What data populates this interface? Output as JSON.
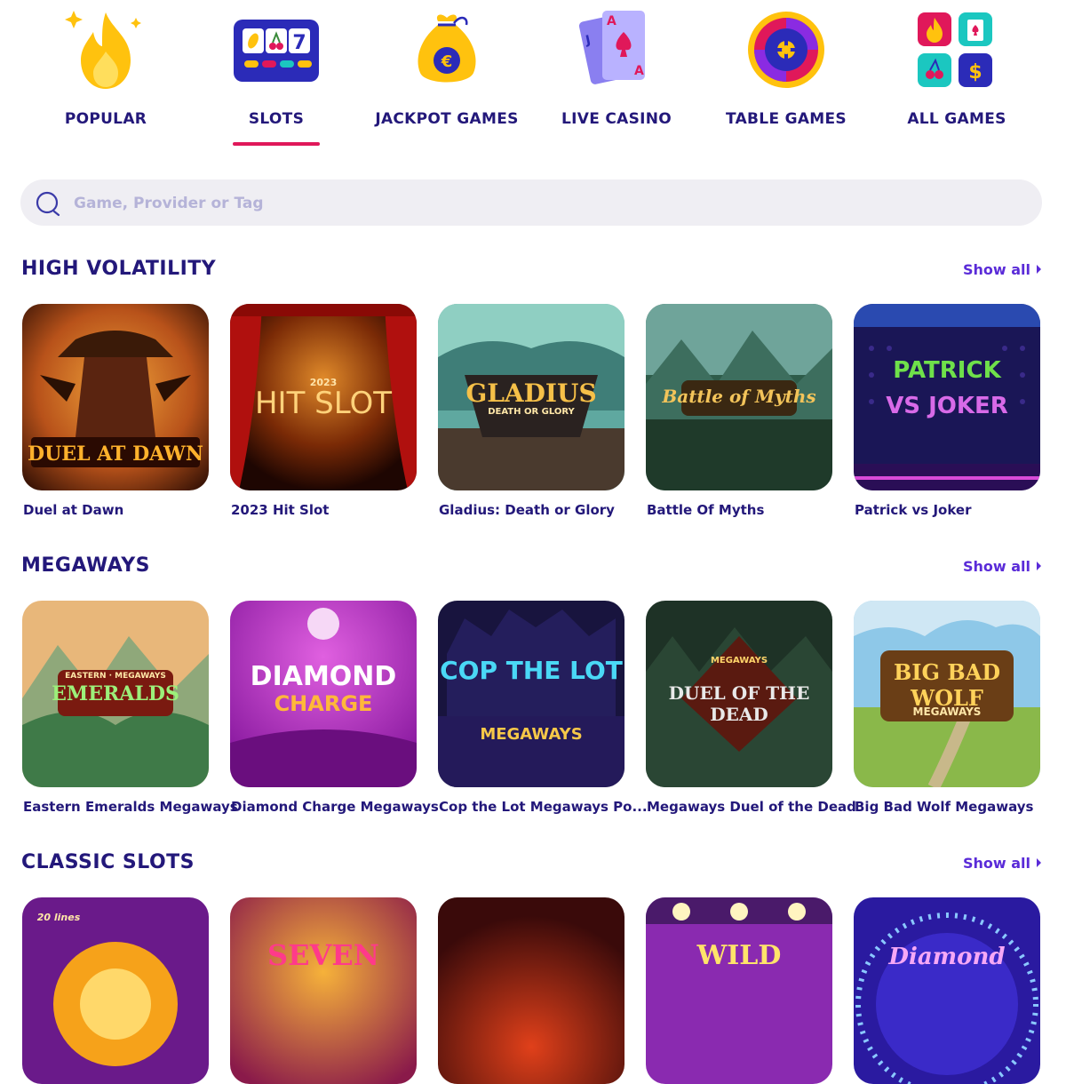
{
  "nav": {
    "categories": [
      {
        "label": "POPULAR",
        "icon": "fire-icon",
        "active": false
      },
      {
        "label": "SLOTS",
        "icon": "slot-machine-icon",
        "active": true
      },
      {
        "label": "JACKPOT GAMES",
        "icon": "money-bag-icon",
        "active": false
      },
      {
        "label": "LIVE CASINO",
        "icon": "playing-cards-icon",
        "active": false
      },
      {
        "label": "TABLE GAMES",
        "icon": "roulette-wheel-icon",
        "active": false
      },
      {
        "label": "ALL GAMES",
        "icon": "grid-tiles-icon",
        "active": false
      }
    ]
  },
  "search": {
    "placeholder": "Game, Provider or Tag",
    "value": ""
  },
  "sections": [
    {
      "title": "HIGH VOLATILITY",
      "show_all": "Show all",
      "games": [
        {
          "name": "Duel at Dawn",
          "art_text": "DUEL AT DAWN"
        },
        {
          "name": "2023 Hit Slot",
          "art_text": "HIT SLOT",
          "art_sub": "2023"
        },
        {
          "name": "Gladius: Death or Glory",
          "art_text": "GLADIUS",
          "art_sub": "DEATH OR GLORY"
        },
        {
          "name": "Battle Of Myths",
          "art_text": "Battle of Myths"
        },
        {
          "name": "Patrick vs Joker",
          "art_text": "PATRICK",
          "art_sub": "VS JOKER"
        }
      ]
    },
    {
      "title": "MEGAWAYS",
      "show_all": "Show all",
      "games": [
        {
          "name": "Eastern Emeralds Megaways",
          "art_text": "EMERALDS",
          "art_sub": "EASTERN · MEGAWAYS"
        },
        {
          "name": "Diamond Charge Megaways",
          "art_text": "DIAMOND",
          "art_sub": "CHARGE"
        },
        {
          "name": "Cop the Lot Megaways Po...",
          "art_text": "COP THE LOT",
          "art_sub": "MEGAWAYS"
        },
        {
          "name": "Megaways Duel of the Dead",
          "art_text": "DUEL OF THE DEAD",
          "art_sub": "MEGAWAYS"
        },
        {
          "name": "Big Bad Wolf Megaways",
          "art_text": "BIG BAD WOLF",
          "art_sub": "MEGAWAYS"
        }
      ]
    },
    {
      "title": "CLASSIC SLOTS",
      "show_all": "Show all",
      "games": [
        {
          "name": "",
          "art_text": "",
          "art_sub": "20 lines"
        },
        {
          "name": "",
          "art_text": "SEVEN"
        },
        {
          "name": "",
          "art_text": ""
        },
        {
          "name": "",
          "art_text": "WILD"
        },
        {
          "name": "",
          "art_text": "Diamond"
        }
      ]
    }
  ],
  "colors": {
    "brand_text": "#23187a",
    "accent_underline": "#e0185a",
    "link": "#5a2bd8",
    "search_bg": "#efeef3"
  }
}
